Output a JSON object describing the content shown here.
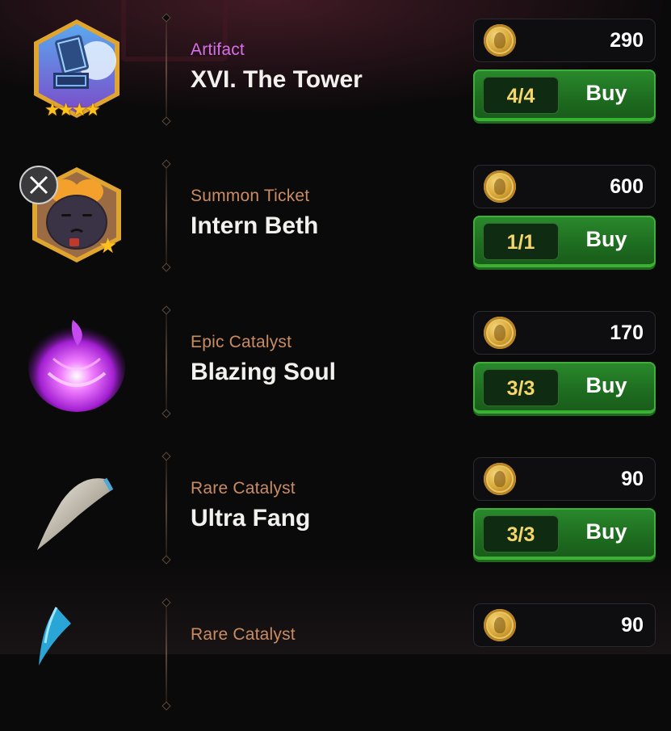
{
  "shop": {
    "items": [
      {
        "category": "Artifact",
        "category_color": "#d66fe8",
        "name": "XVI. The Tower",
        "icon": "tower-artifact-icon",
        "stars": "★★★★",
        "price": "290",
        "stock": "4/4",
        "buy_label": "Buy"
      },
      {
        "category": "Summon Ticket",
        "category_color": "#c98c62",
        "name": "Intern Beth",
        "icon": "beth-summon-ticket-icon",
        "stars": "★",
        "price": "600",
        "stock": "1/1",
        "buy_label": "Buy"
      },
      {
        "category": "Epic Catalyst",
        "category_color": "#c98c62",
        "name": "Blazing Soul",
        "icon": "purple-flame-icon",
        "price": "170",
        "stock": "3/3",
        "buy_label": "Buy"
      },
      {
        "category": "Rare Catalyst",
        "category_color": "#c98c62",
        "name": "Ultra Fang",
        "icon": "fang-icon",
        "price": "90",
        "stock": "3/3",
        "buy_label": "Buy"
      },
      {
        "category": "Rare Catalyst",
        "category_color": "#c98c62",
        "name": "",
        "icon": "blue-claw-icon",
        "price": "90"
      }
    ],
    "currency_icon": "gold-coin-icon"
  }
}
